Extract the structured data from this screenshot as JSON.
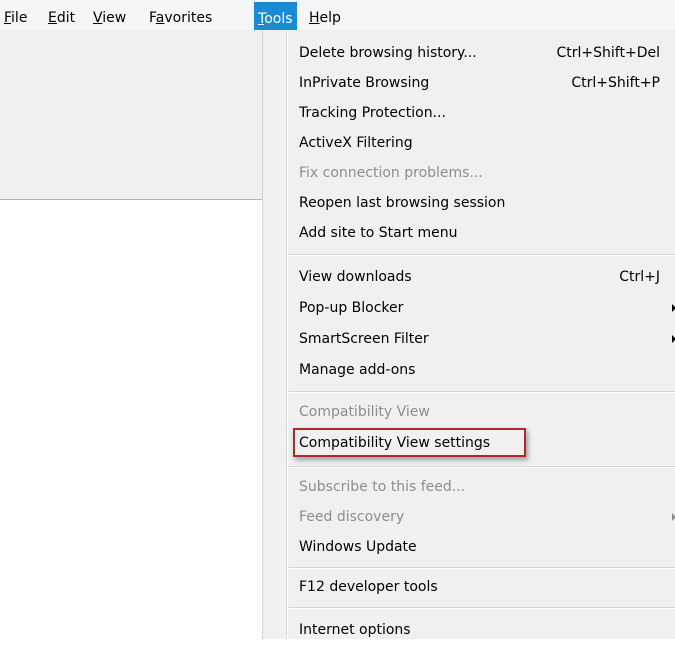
{
  "menubar": {
    "items": [
      {
        "accel": "F",
        "rest": "ile"
      },
      {
        "accel": "E",
        "rest": "dit"
      },
      {
        "accel": "V",
        "rest": "iew"
      },
      {
        "pre": "F",
        "accel": "a",
        "rest": "vorites"
      },
      {
        "accel": "T",
        "rest": "ools"
      },
      {
        "accel": "H",
        "rest": "elp"
      }
    ]
  },
  "tools_menu": {
    "items": [
      {
        "label": "Delete browsing history...",
        "shortcut": "Ctrl+Shift+Del"
      },
      {
        "label": "InPrivate Browsing",
        "shortcut": "Ctrl+Shift+P"
      },
      {
        "label": "Tracking Protection..."
      },
      {
        "label": "ActiveX Filtering"
      },
      {
        "label": "Fix connection problems..."
      },
      {
        "label": "Reopen last browsing session"
      },
      {
        "label": "Add site to Start menu"
      },
      {
        "label": "View downloads",
        "shortcut": "Ctrl+J"
      },
      {
        "label": "Pop-up Blocker"
      },
      {
        "label": "SmartScreen Filter"
      },
      {
        "label": "Manage add-ons"
      },
      {
        "label": "Compatibility View"
      },
      {
        "label": "Compatibility View settings"
      },
      {
        "label": "Subscribe to this feed..."
      },
      {
        "label": "Feed discovery"
      },
      {
        "label": "Windows Update"
      },
      {
        "label": "F12 developer tools"
      },
      {
        "label": "Internet options"
      }
    ]
  },
  "colors": {
    "menubar_active": "#1a8ad3",
    "highlight_border": "#b3262b",
    "disabled_text": "#8d8d8d"
  }
}
